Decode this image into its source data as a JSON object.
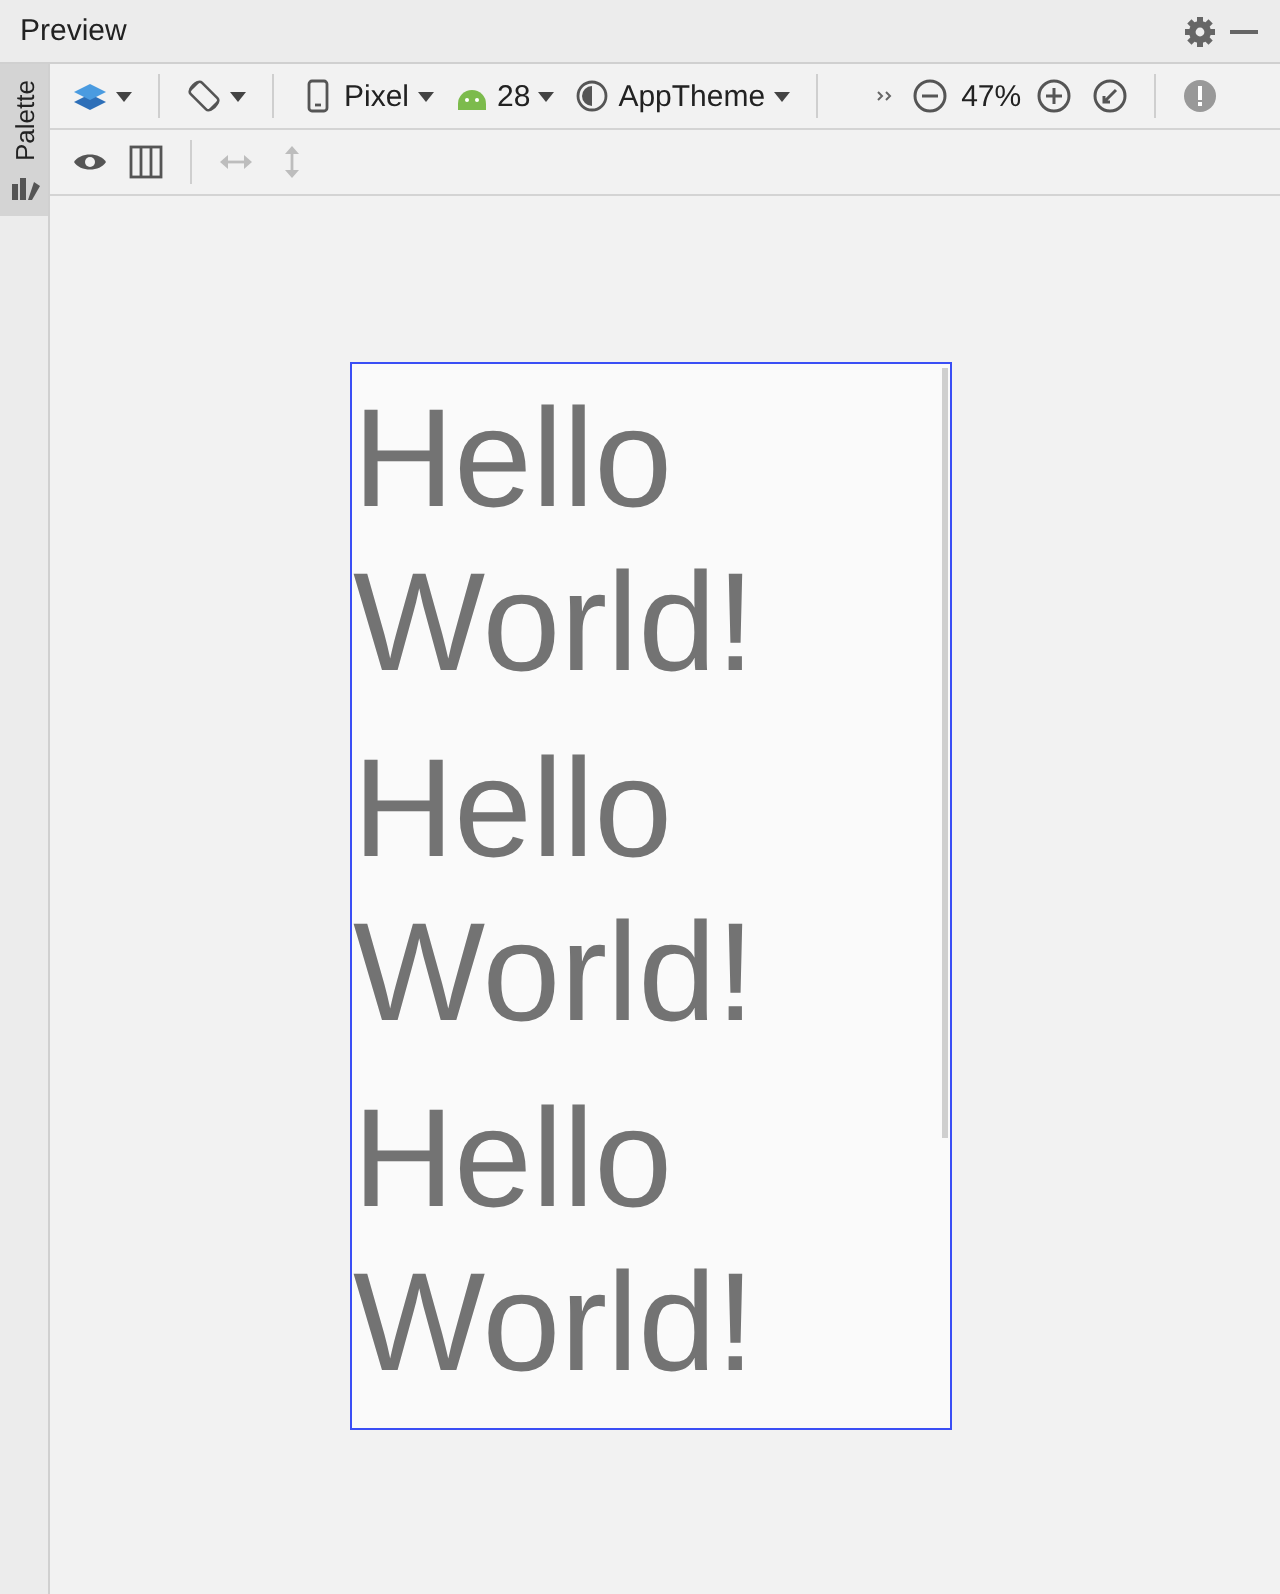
{
  "window": {
    "title": "Preview"
  },
  "side_tab": {
    "label": "Palette",
    "selected": true
  },
  "toolbar": {
    "device": "Pixel",
    "api": "28",
    "theme": "AppTheme",
    "zoom": "47%"
  },
  "view_toolbar": [
    {
      "kind": "eye",
      "disabled": false
    },
    {
      "kind": "columns",
      "disabled": false
    },
    {
      "kind": "horizontal",
      "disabled": true
    },
    {
      "kind": "vertical",
      "disabled": true
    }
  ],
  "device_preview": {
    "texts": [
      "Hello World!",
      "Hello World!",
      "Hello World!"
    ]
  }
}
